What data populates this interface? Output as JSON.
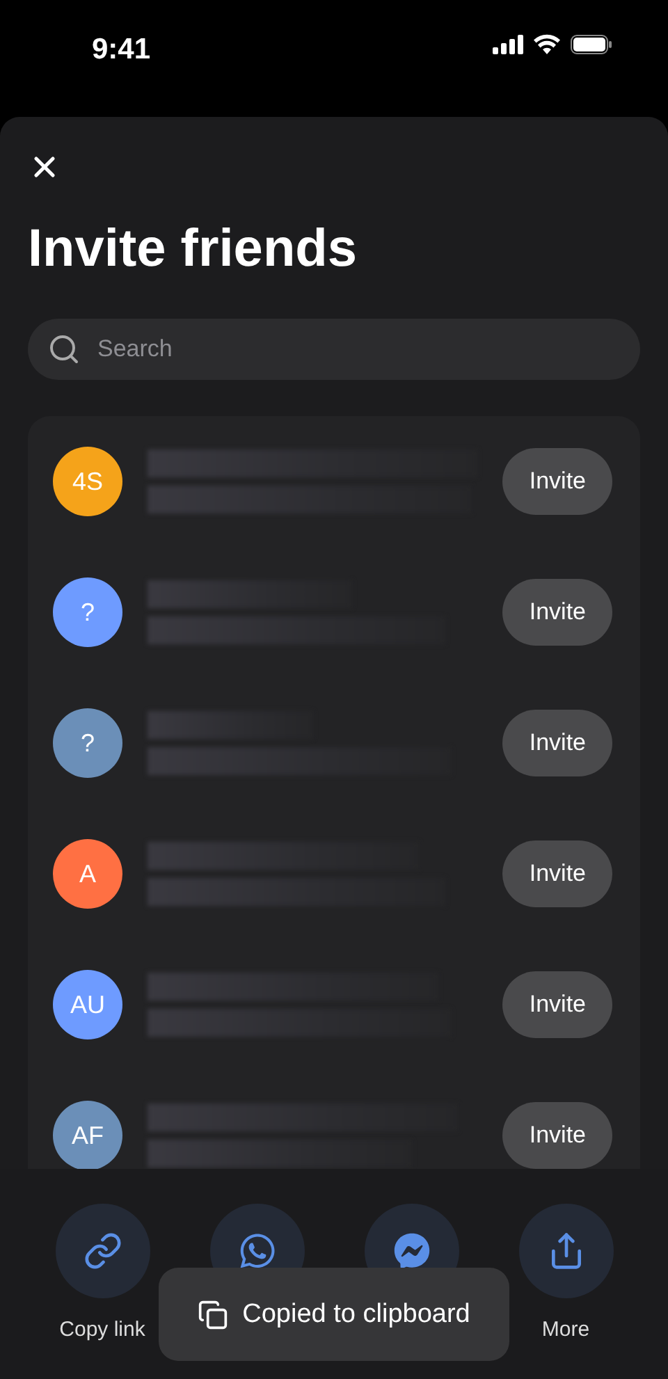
{
  "status_bar": {
    "time": "9:41"
  },
  "sheet": {
    "title": "Invite friends"
  },
  "search": {
    "placeholder": "Search"
  },
  "contacts": [
    {
      "initials": "4S",
      "color": "#f5a31a",
      "action": "Invite"
    },
    {
      "initials": "?",
      "color": "#6e9bff",
      "action": "Invite"
    },
    {
      "initials": "?",
      "color": "#6b8fb8",
      "action": "Invite"
    },
    {
      "initials": "A",
      "color": "#ff7043",
      "action": "Invite"
    },
    {
      "initials": "AU",
      "color": "#6e9bff",
      "action": "Invite"
    },
    {
      "initials": "AF",
      "color": "#6b8fb8",
      "action": "Invite"
    }
  ],
  "share_options": [
    {
      "kind": "link",
      "label": "Copy link"
    },
    {
      "kind": "whatsapp"
    },
    {
      "kind": "messenger"
    },
    {
      "kind": "share",
      "label": "More"
    }
  ],
  "toast": {
    "message": "Copied to clipboard"
  }
}
